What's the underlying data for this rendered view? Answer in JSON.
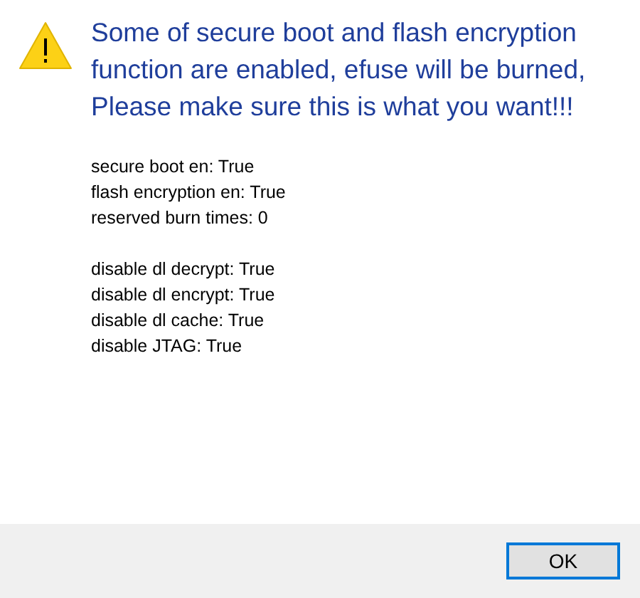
{
  "message": {
    "kind": "warning",
    "heading": "Some of secure boot and flash encryption function are enabled, efuse will be burned, Please make sure this is what you want!!!"
  },
  "detail_groups": [
    [
      "secure boot en: True",
      "flash encryption en: True",
      "reserved burn times: 0"
    ],
    [
      "disable dl decrypt: True",
      "disable dl encrypt: True",
      "disable dl cache: True",
      "disable JTAG: True"
    ]
  ],
  "buttons": [
    {
      "label": "OK",
      "selected": true
    }
  ]
}
